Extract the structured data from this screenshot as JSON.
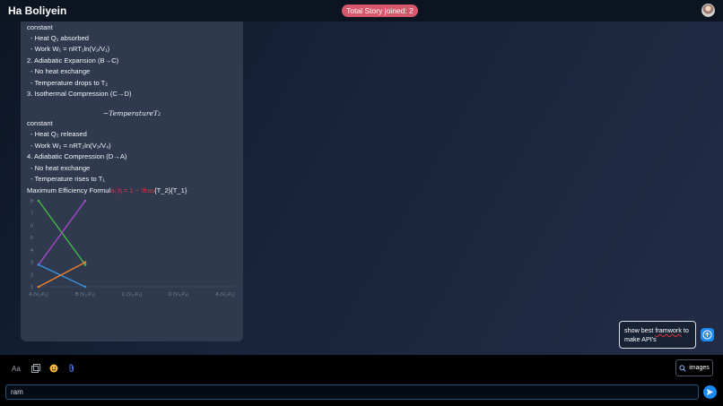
{
  "header": {
    "title": "Ha Boliyein",
    "badge": "Total Story joined: 2"
  },
  "message": {
    "lines": [
      "constant",
      "- Heat Q₁ absorbed",
      "- Work W₁ = nRT₁ln(V₂/V₁)",
      "2. Adiabatic Expansion (B→C)",
      "- No heat exchange",
      "- Temperature drops to T₂",
      "3. Isothermal Compression (C→D)",
      "−TemperatureT₂",
      "constant",
      "- Heat Q₂ released",
      "- Work W₂ = nRT₂ln(V₃/V₄)",
      "4. Adiabatic Compression (D→A)",
      "- No heat exchange",
      "- Temperature rises to T₁"
    ],
    "efficiency_prefix": "Maximum Efficiency Formul",
    "efficiency_red": "a: η = 1 − \\frac",
    "efficiency_suffix": "{T_2}{T_1}"
  },
  "chart_data": {
    "type": "line",
    "categories": [
      "A (V₁,P₁)",
      "B (V₂,P₂)",
      "C (V₃,P₃)",
      "D (V₄,P₄)",
      "A (V₁,P₁)"
    ],
    "y_ticks": [
      "1",
      "2",
      "3",
      "4",
      "5",
      "6",
      "7",
      "8"
    ],
    "ylim": [
      1,
      8
    ],
    "series": [
      {
        "color": "#45b649",
        "points": [
          [
            0,
            8
          ],
          [
            1,
            2.8
          ]
        ]
      },
      {
        "color": "#a347c8",
        "points": [
          [
            0,
            2.8
          ],
          [
            1,
            8
          ]
        ]
      },
      {
        "color": "#3a8ed8",
        "points": [
          [
            0,
            2.8
          ],
          [
            1,
            1
          ]
        ]
      },
      {
        "color": "#f0802c",
        "points": [
          [
            0,
            1
          ],
          [
            1,
            3
          ]
        ]
      }
    ]
  },
  "composer": {
    "bubble_text_1": "show best ",
    "bubble_text_misspelled": "framwork",
    "bubble_text_2": " to make API's",
    "images_label": "images",
    "font_label": "Aa",
    "input_value": "ram"
  }
}
